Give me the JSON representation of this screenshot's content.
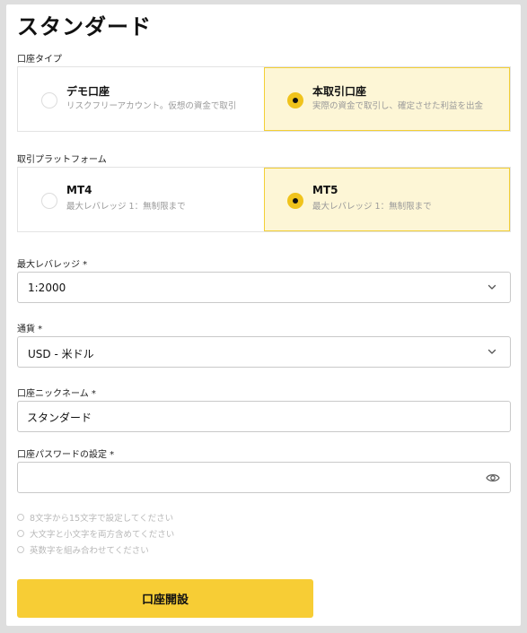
{
  "page": {
    "title": "スタンダード"
  },
  "account_type": {
    "label": "口座タイプ",
    "options": [
      {
        "title": "デモ口座",
        "description": "リスクフリーアカウント。仮想の資金で取引",
        "selected": false
      },
      {
        "title": "本取引口座",
        "description": "実際の資金で取引し、確定させた利益を出金",
        "selected": true
      }
    ]
  },
  "platform": {
    "label": "取引プラットフォーム",
    "options": [
      {
        "title": "MT4",
        "description": "最大レバレッジ 1：無制限まで",
        "selected": false
      },
      {
        "title": "MT5",
        "description": "最大レバレッジ 1：無制限まで",
        "selected": true
      }
    ]
  },
  "leverage": {
    "label": "最大レバレッジ *",
    "value": "1:2000",
    "icon": "chevron-down-icon"
  },
  "currency": {
    "label": "通貨 *",
    "value": "USD - 米ドル",
    "icon": "chevron-down-icon"
  },
  "nickname": {
    "label": "口座ニックネーム *",
    "value": "スタンダード"
  },
  "password": {
    "label": "口座パスワードの設定 *",
    "value": "",
    "icon": "eye-icon"
  },
  "password_rules": [
    "8文字から15文字で設定してください",
    "大文字と小文字を両方含めてください",
    "英数字を組み合わせてください"
  ],
  "submit": {
    "label": "口座開設",
    "color": "#f7cd35"
  },
  "colors": {
    "accent": "#f0c31c",
    "selected_bg": "#fdf6d6",
    "selected_border": "#f3cf36"
  }
}
